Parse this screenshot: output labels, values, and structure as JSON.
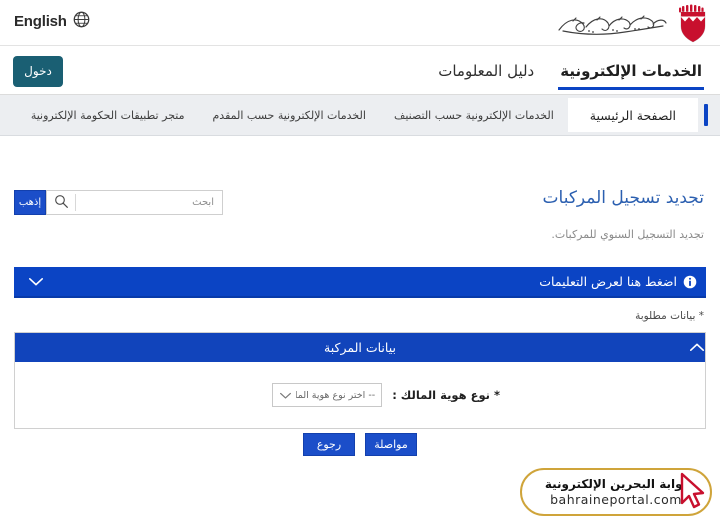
{
  "topbar": {
    "language_label": "English",
    "globe_icon": "globe-icon",
    "crest_alt": "bahrain-coat-of-arms",
    "gov_wordmark": "حكومة مملكة البحرين"
  },
  "navrow": {
    "login_label": "دخول",
    "tabs": [
      {
        "label": "الخدمات الإلكترونية",
        "active": true
      },
      {
        "label": "دليل المعلومات",
        "active": false
      }
    ]
  },
  "subnav": {
    "items": [
      {
        "label": "الصفحة الرئيسية",
        "current": true
      },
      {
        "label": "الخدمات الإلكترونية حسب التصنيف",
        "current": false
      },
      {
        "label": "الخدمات الإلكترونية حسب المقدم",
        "current": false
      },
      {
        "label": "متجر تطبيقات الحكومة الإلكترونية",
        "current": false
      }
    ]
  },
  "search": {
    "go_label": "إذهب",
    "placeholder": "ابحث",
    "value": "",
    "icon": "search-icon"
  },
  "service": {
    "title": "تجديد تسجيل المركبات",
    "subtitle": "تجديد التسجيل السنوي للمركبات."
  },
  "instructions": {
    "label": "اضغط هنا لعرض التعليمات",
    "info_icon": "info-icon",
    "chevron": "chevron-down-icon",
    "expanded": false
  },
  "required_note": "* بيانات مطلوبة",
  "panel": {
    "title": "بيانات المركبة",
    "chevron": "chevron-up-icon",
    "expanded": true,
    "fields": [
      {
        "label": "* نوع هوية المالك :",
        "control": "select",
        "selected": "-- اختر نوع هوية المالك --",
        "options": [
          "-- اختر نوع هوية المالك --"
        ]
      }
    ]
  },
  "actions": {
    "continue_label": "مواصلة",
    "back_label": "رجوع"
  },
  "watermark": {
    "arabic": "بوابة البحرين الإلكترونية",
    "latin": "bahraineportal.com",
    "cursor_icon": "mouse-cursor-icon"
  },
  "colors": {
    "primary_blue": "#0b44c4",
    "button_blue": "#1b4ec9",
    "login_teal": "#1a5f73",
    "title_blue": "#2b5fb0",
    "subnav_bg": "#eceef1",
    "watermark_gold": "#cfa43a",
    "crest_red": "#c8102e"
  }
}
